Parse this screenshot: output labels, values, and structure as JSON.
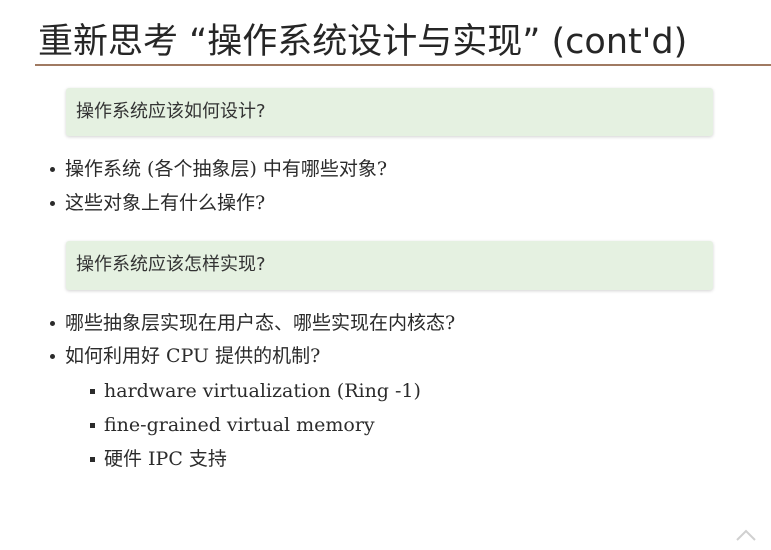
{
  "slide": {
    "title": "重新思考 “操作系统设计与实现” (cont'd)",
    "design_box": "操作系统应该如何设计?",
    "design_bullets": [
      "操作系统 (各个抽象层) 中有哪些对象?",
      "这些对象上有什么操作?"
    ],
    "impl_box": "操作系统应该怎样实现?",
    "impl_bullets": [
      "哪些抽象层实现在用户态、哪些实现在内核态?",
      "如何利用好 CPU 提供的机制?"
    ],
    "cpu_sub_bullets": [
      "hardware virtualization (Ring -1)",
      "fine-grained virtual memory",
      "硬件 IPC 支持"
    ]
  },
  "colors": {
    "box_background": "#e5f1e1",
    "title_rule": "#a07a62"
  },
  "icons": [
    "chevron-up-icon"
  ]
}
